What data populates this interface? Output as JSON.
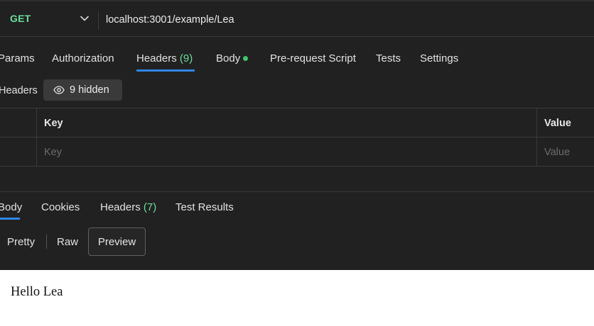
{
  "request": {
    "method": "GET",
    "url": "localhost:3001/example/Lea"
  },
  "request_tabs": {
    "params": "Params",
    "authorization": "Authorization",
    "headers": "Headers",
    "headers_count": "(9)",
    "body": "Body",
    "pre_request_script": "Pre-request Script",
    "tests": "Tests",
    "settings": "Settings"
  },
  "headers_section": {
    "label": "Headers",
    "hidden_button": "9 hidden"
  },
  "headers_table": {
    "columns": [
      "Key",
      "Value"
    ],
    "placeholders": [
      "Key",
      "Value"
    ]
  },
  "response_tabs": {
    "body": "Body",
    "cookies": "Cookies",
    "headers": "Headers",
    "headers_count": "(7)",
    "test_results": "Test Results"
  },
  "view_modes": {
    "pretty": "Pretty",
    "raw": "Raw",
    "preview": "Preview",
    "selected": "Preview"
  },
  "preview": {
    "content": "Hello Lea"
  },
  "icons": {
    "method_dropdown": "chevron-down-icon",
    "hidden_toggle": "eye-icon"
  },
  "colors": {
    "background": "#212121",
    "method_accent": "#6bdd9a",
    "active_tab_underline": "#2f86e8",
    "body_dot": "#3fc66b"
  }
}
